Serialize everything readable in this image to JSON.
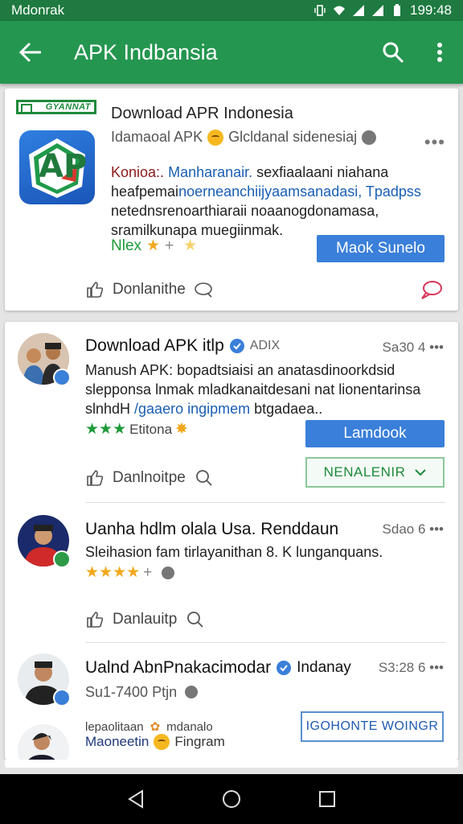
{
  "status_bar": {
    "carrier": "Mdonrak",
    "time": "199:48"
  },
  "app_bar": {
    "title": "APK Indbansia"
  },
  "featured": {
    "badge": "GYANNAT",
    "logo_text": "AP",
    "title": "Download APR Indonesia",
    "subtitle_left": "Idamaoal APK",
    "subtitle_right": "Glcldanal sidenesiaj",
    "description_prefix": "Konioa:.",
    "description_link1": "Manharanair.",
    "description_line1_rest": " sexfiaalaani niahana",
    "description_line2_start": "heafpemai",
    "description_link2": "noerneanchiijyaamsanadasi, Tpadpss",
    "description_line3": "netednsrenoarthiaraii noaanogdonamasa,",
    "description_line4": "sramilkunapa muegiinmak.",
    "rating_label": "Nlex",
    "button_label": "Maok Sunelo",
    "action_label": "Donlanithe"
  },
  "posts": [
    {
      "name": "Download APK itlp",
      "extra": "ADIX",
      "time": "Sa30 4",
      "text_line1": "Manush APK: bopadtsiaisi an anatasdinoorkdsid",
      "text_line2": "slepponsa lnmak mladkanaitdesani nat lionentarinsa",
      "text_line3_start": "slnhdH ",
      "text_link": "/gaaero ingipmem",
      "text_line3_end": " btgadaea..",
      "rating_label": "Etitona",
      "primary_button": "Lamdook",
      "secondary_button": "NENALENIR",
      "action_label": "Danlnoitpe"
    },
    {
      "name": "Uanha hdlm olala Usa. Renddaun",
      "time": "Sdao 6",
      "text_line1": "Sleihasion fam tirlayanithan 8. K lunganquans.",
      "action_label": "Danlauitp"
    },
    {
      "name": "Ualnd AbnPnakacimodar",
      "name_suffix": "Indanay",
      "time": "S3:28 6",
      "meta": "Su1-7400 Ptjn",
      "foot_left1": "lepaolitaan",
      "foot_right1": "mdanalo",
      "foot_left2": "Maoneetin",
      "foot_right2": "Fingram",
      "button": "IGOHONTE WOINGR"
    }
  ],
  "colors": {
    "statusbar": "#1e7a40",
    "appbar": "#24964f",
    "accent_blue": "#3a7fd9",
    "green": "#1e9a3a",
    "star": "#f2a81e"
  }
}
